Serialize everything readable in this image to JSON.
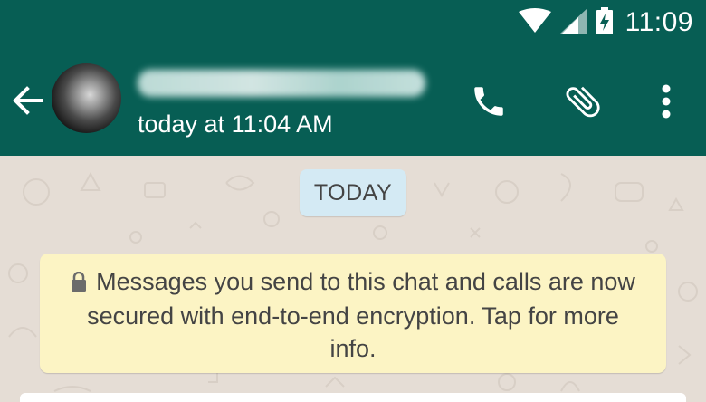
{
  "status_bar": {
    "time": "11:09",
    "icons": [
      "wifi-icon",
      "signal-icon",
      "battery-charging-icon"
    ],
    "bg_color": "#075e54"
  },
  "header": {
    "last_seen": "today at 11:04 AM",
    "icons": [
      "back-arrow-icon",
      "phone-icon",
      "paperclip-icon",
      "overflow-menu-icon"
    ],
    "bg_color": "#075e54"
  },
  "chat": {
    "date_label": "TODAY",
    "encryption_notice": "Messages you send to this chat and calls are now secured with end-to-end encryption. Tap for more info.",
    "notice_icon": "lock-icon",
    "colors": {
      "wallpaper": "#e5ddd5",
      "date_chip": "#d4eaf4",
      "notice_bubble": "#fcf4c4"
    }
  }
}
